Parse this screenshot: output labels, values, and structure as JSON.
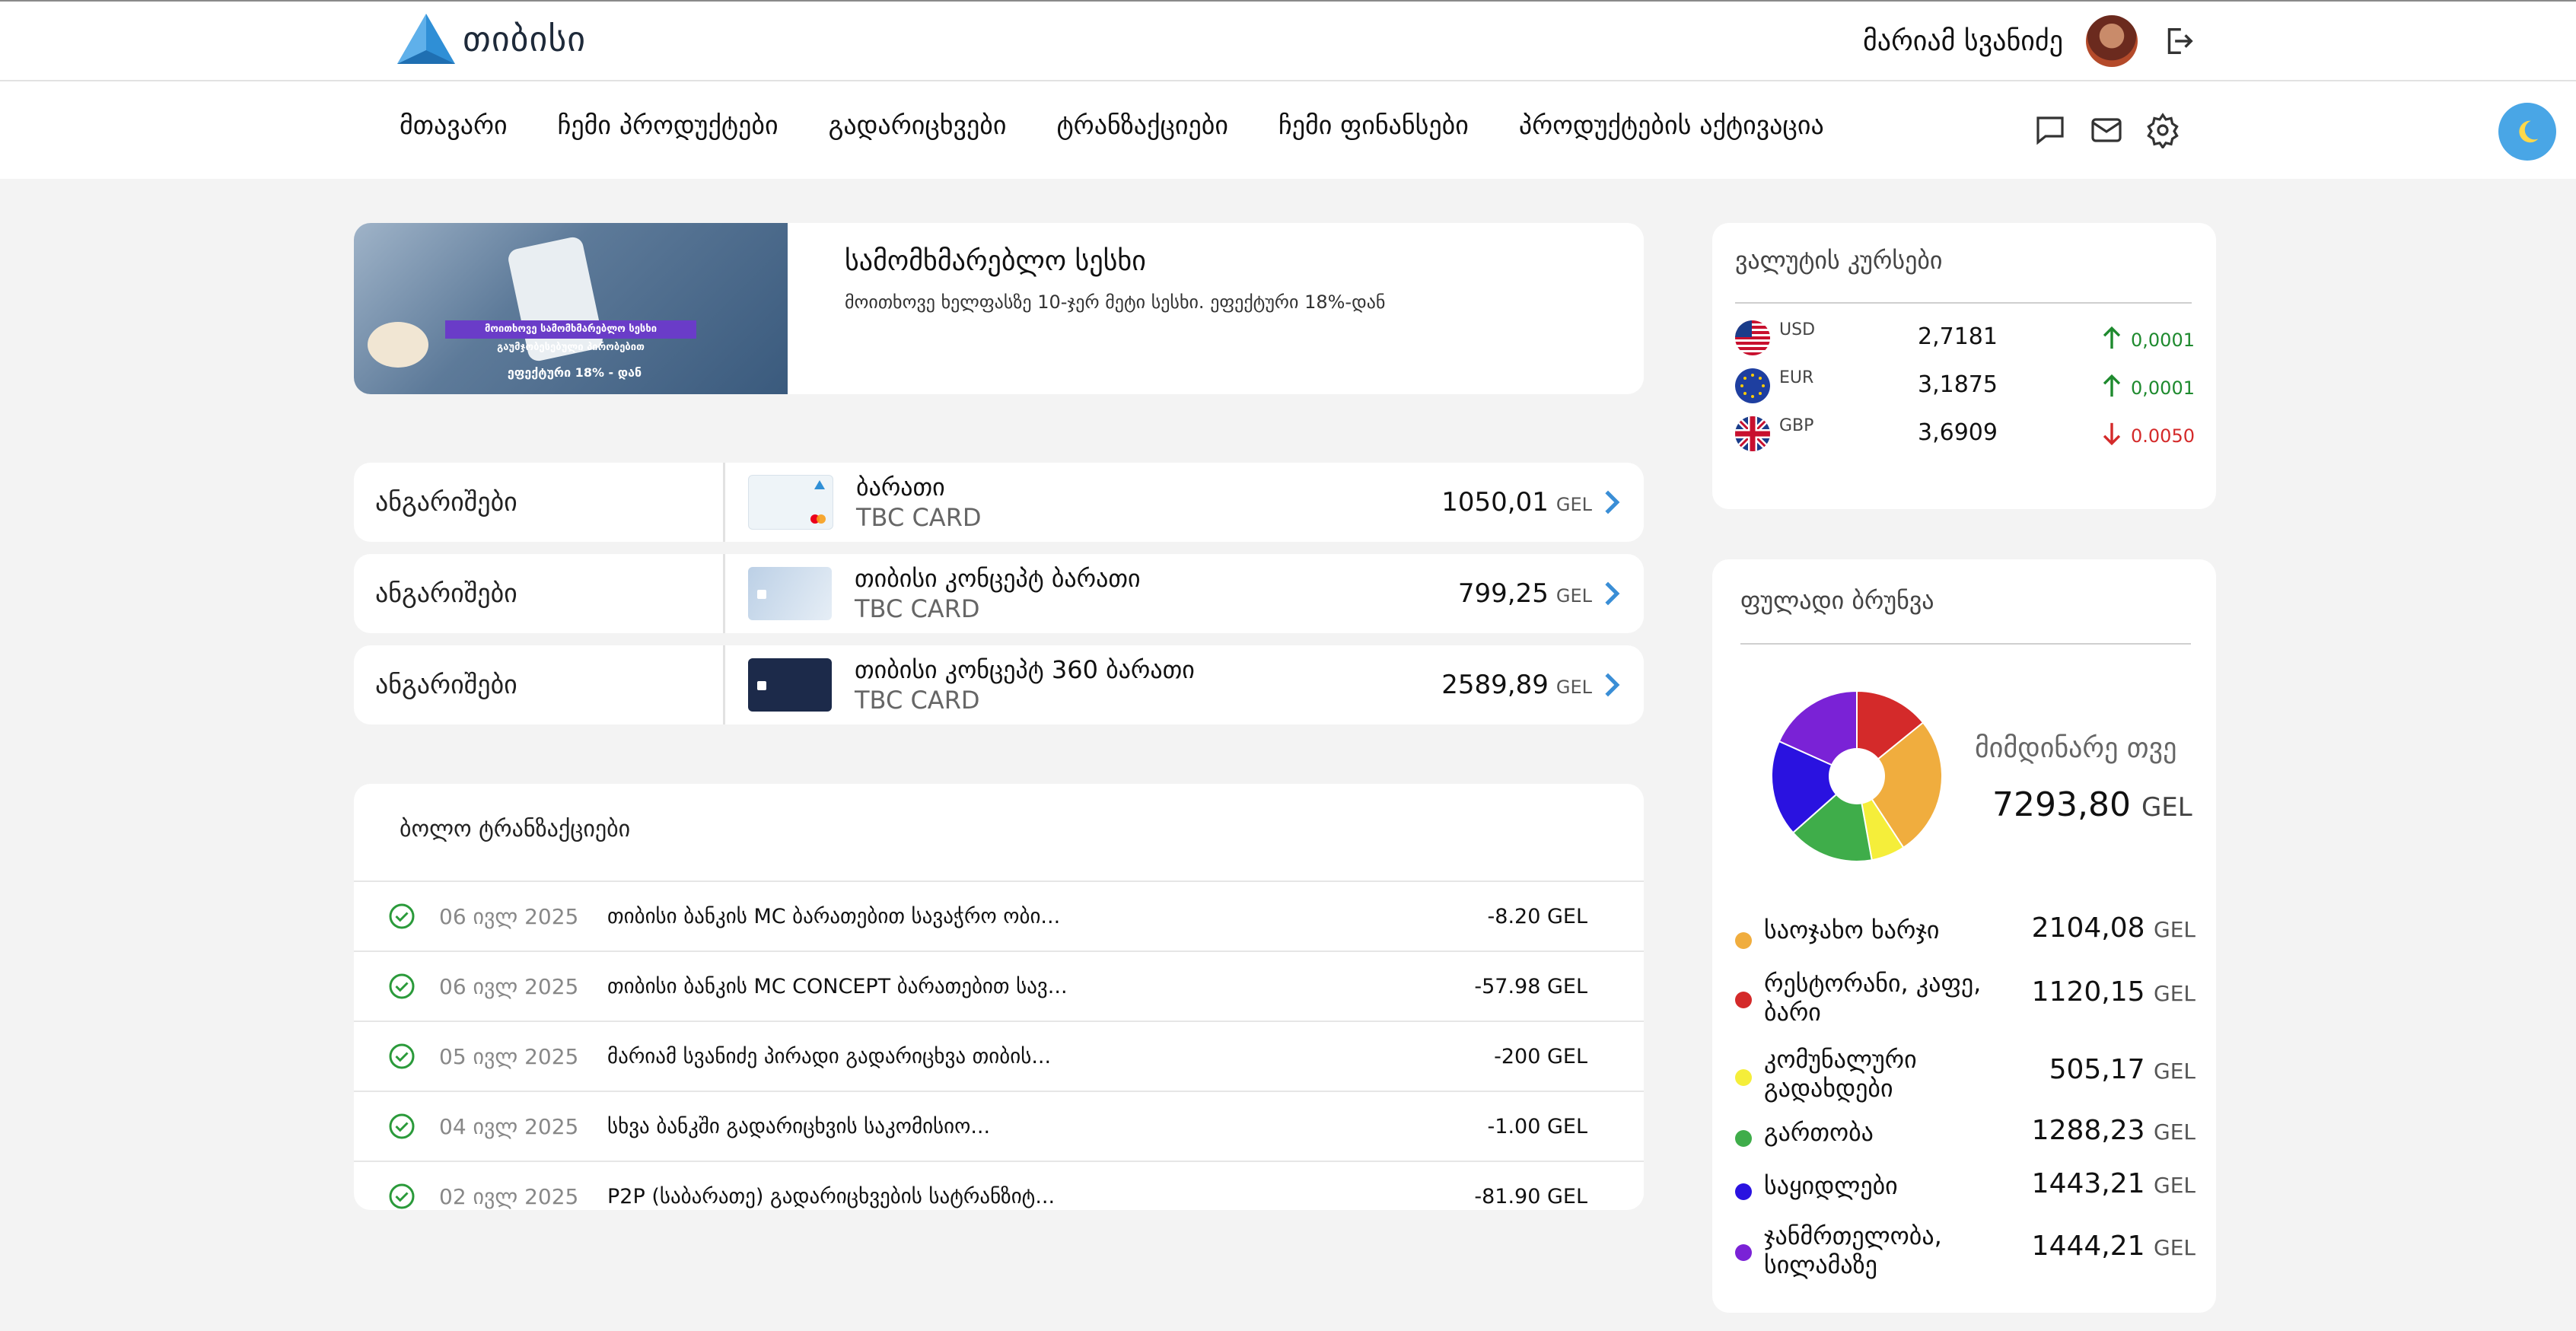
{
  "app": {
    "logo_text": "თიბისი",
    "user_name": "მარიამ სვანიძე"
  },
  "nav": {
    "items": [
      {
        "label": "მთავარი"
      },
      {
        "label": "ჩემი პროდუქტები"
      },
      {
        "label": "გადარიცხვები"
      },
      {
        "label": "ტრანზაქციები"
      },
      {
        "label": "ჩემი ფინანსები"
      },
      {
        "label": "პროდუქტების აქტივაცია"
      }
    ]
  },
  "promo": {
    "title": "სამომხმარებლო სესხი",
    "subtitle": "მოითხოვე ხელფასზე 10-ჯერ მეტი სესხი. ეფექტური 18%-დან",
    "banner_line1": "მოითხოვე სამომხმარებლო სესხი გაუმჯობესებული პირობებით",
    "banner_line2": "ეფექტური 18% - დან"
  },
  "accounts": [
    {
      "label": "ანგარიშები",
      "name": "ბარათი",
      "type": "TBC CARD",
      "amount": "1050,01",
      "currency": "GEL"
    },
    {
      "label": "ანგარიშები",
      "name": "თიბისი კონცეპტ ბარათი",
      "type": "TBC CARD",
      "amount": "799,25",
      "currency": "GEL"
    },
    {
      "label": "ანგარიშები",
      "name": "თიბისი კონცეპტ 360 ბარათი",
      "type": "TBC CARD",
      "amount": "2589,89",
      "currency": "GEL"
    }
  ],
  "transactions": {
    "title": "ბოლო ტრანზაქციები",
    "rows": [
      {
        "date": "06 ივლ 2025",
        "desc": "თიბისი ბანკის MC ბარათებით სავაჭრო ობი...",
        "amount": "-8.20 GEL"
      },
      {
        "date": "06 ივლ 2025",
        "desc": "თიბისი ბანკის MC CONCEPT ბარათებით სავ...",
        "amount": "-57.98 GEL"
      },
      {
        "date": "05 ივლ 2025",
        "desc": "მარიამ სვანიძე პირადი გადარიცხვა თიბის...",
        "amount": "-200 GEL"
      },
      {
        "date": "04 ივლ 2025",
        "desc": "სხვა ბანკში გადარიცხვის საკომისიო...",
        "amount": "-1.00 GEL"
      },
      {
        "date": "02 ივლ 2025",
        "desc": "P2P (საბარათე) გადარიცხვების სატრანზიტ...",
        "amount": "-81.90 GEL"
      }
    ]
  },
  "rates": {
    "title": "ვალუტის კურსები",
    "rows": [
      {
        "code": "USD",
        "value": "2,7181",
        "change": "0,0001",
        "direction": "up",
        "color": "#1e8a2e"
      },
      {
        "code": "EUR",
        "value": "3,1875",
        "change": "0,0001",
        "direction": "up",
        "color": "#1e8a2e"
      },
      {
        "code": "GBP",
        "value": "3,6909",
        "change": "0.0050",
        "direction": "down",
        "color": "#d42a2a"
      }
    ]
  },
  "cashflow": {
    "title": "ფულადი ბრუნვა",
    "period": "მიმდინარე თვე",
    "total": "7293,80",
    "currency": "GEL",
    "items": [
      {
        "name": "საოჯახო ხარჯი",
        "value": "2104,08",
        "amount": 2104.08,
        "color": "#f0ad3e"
      },
      {
        "name": "რესტორანი, კაფე, ბარი",
        "value": "1120,15",
        "amount": 1120.15,
        "color": "#d42a2a"
      },
      {
        "name": "კომუნალური გადახდები",
        "value": "505,17",
        "amount": 505.17,
        "color": "#f5ee3a"
      },
      {
        "name": "გართობა",
        "value": "1288,23",
        "amount": 1288.23,
        "color": "#3fad4a"
      },
      {
        "name": "საყიდლები",
        "value": "1443,21",
        "amount": 1443.21,
        "color": "#2a12e0"
      },
      {
        "name": "ჯანმრთელობა, სილამაზე",
        "value": "1444,21",
        "amount": 1444.21,
        "color": "#7a22d6"
      }
    ]
  }
}
